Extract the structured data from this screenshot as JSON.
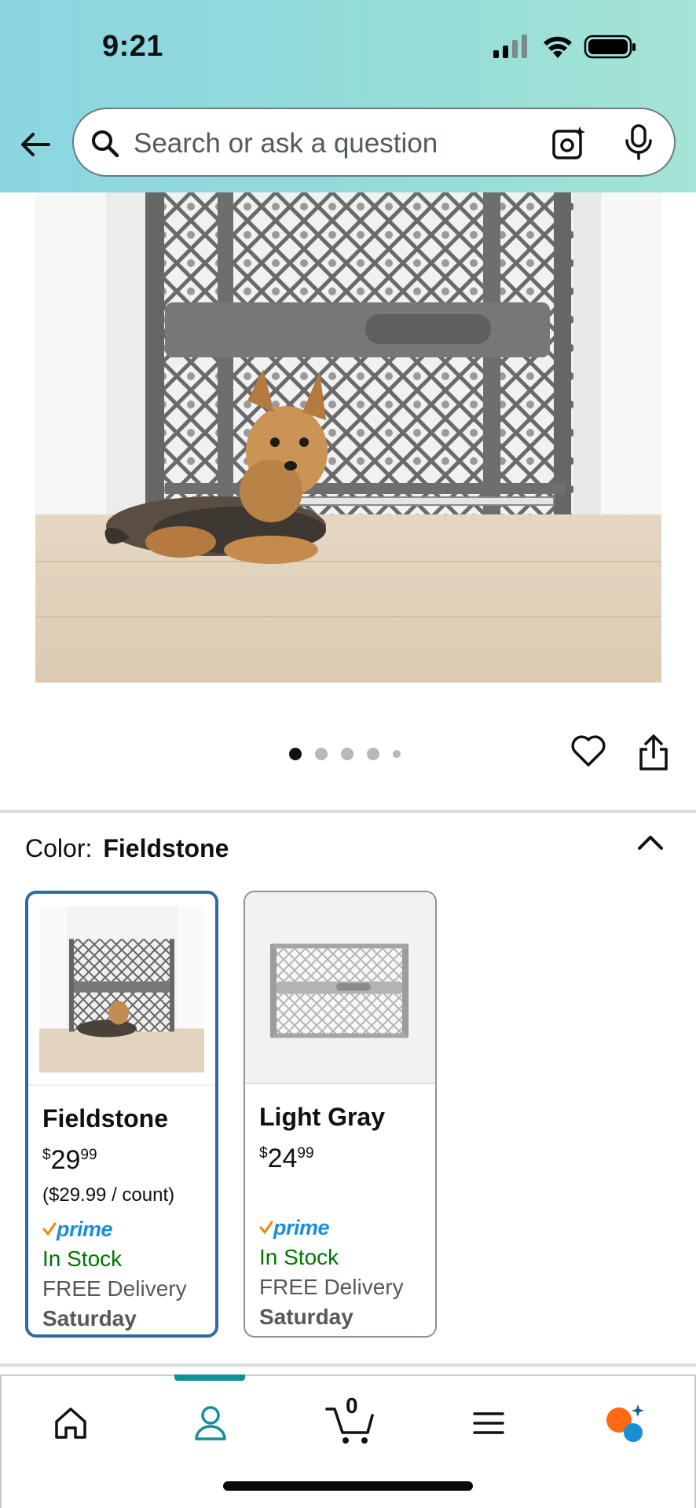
{
  "status_bar": {
    "time": "9:21"
  },
  "search": {
    "placeholder": "Search or ask a question"
  },
  "carousel": {
    "total_images": 5,
    "active_index": 0
  },
  "color_selector": {
    "label": "Color:",
    "selected_value": "Fieldstone",
    "options": [
      {
        "name": "Fieldstone",
        "price_symbol": "$",
        "price_whole": "29",
        "price_fraction": "99",
        "unit_price": "($29.99 / count)",
        "prime": "prime",
        "stock": "In Stock",
        "delivery": "FREE Delivery",
        "delivery_day": "Saturday",
        "selected": true
      },
      {
        "name": "Light Gray",
        "price_symbol": "$",
        "price_whole": "24",
        "price_fraction": "99",
        "unit_price": "",
        "prime": "prime",
        "stock": "In Stock",
        "delivery": "FREE Delivery",
        "delivery_day": "Saturday",
        "selected": false
      }
    ]
  },
  "bottom_nav": {
    "cart_count": "0",
    "items": [
      "home-icon",
      "account-icon",
      "cart-icon",
      "menu-icon",
      "rufus-ai-icon"
    ],
    "active": "account-icon"
  },
  "colors": {
    "header_gradient_start": "#8bd6e1",
    "header_gradient_end": "#a5e4d6",
    "selected_border": "#2f6ba3",
    "in_stock_green": "#007600",
    "prime_blue": "#1a8fd8",
    "nav_active": "#138f9b"
  }
}
